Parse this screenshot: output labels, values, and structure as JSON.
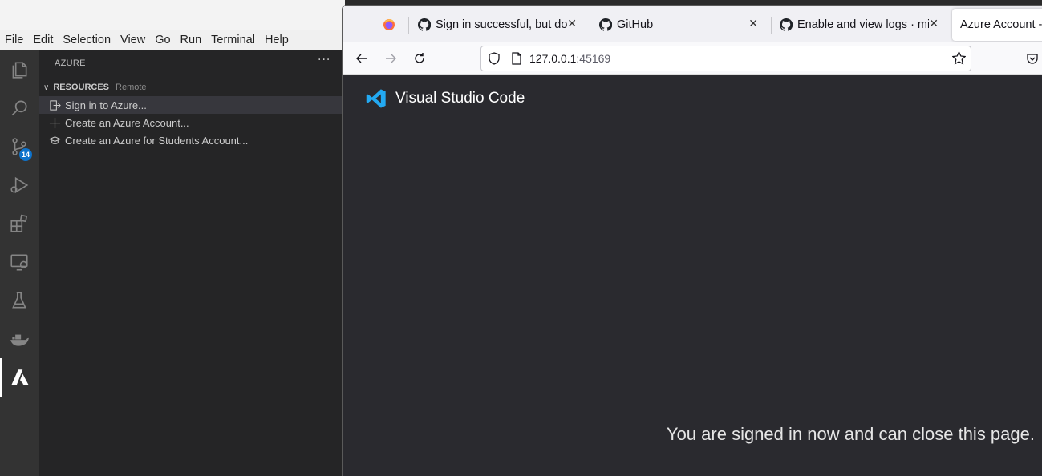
{
  "vscode": {
    "menu": [
      "File",
      "Edit",
      "Selection",
      "View",
      "Go",
      "Run",
      "Terminal",
      "Help"
    ],
    "activity_bar": {
      "source_control_badge": "14",
      "items": [
        "explorer-icon",
        "search-icon",
        "source-control-icon",
        "run-debug-icon",
        "extensions-icon",
        "remote-explorer-icon",
        "testing-icon",
        "docker-icon",
        "azure-icon"
      ]
    },
    "sidebar": {
      "title": "AZURE",
      "more_actions": "···",
      "section": {
        "label": "RESOURCES",
        "description": "Remote"
      },
      "items": [
        {
          "label": "Sign in to Azure...",
          "icon": "sign-in-icon"
        },
        {
          "label": "Create an Azure Account...",
          "icon": "plus-icon"
        },
        {
          "label": "Create an Azure for Students Account...",
          "icon": "mortarboard-icon"
        }
      ]
    }
  },
  "firefox": {
    "tabs": [
      {
        "title": "Sign in successful, but do",
        "icon": "github-icon"
      },
      {
        "title": "GitHub",
        "icon": "github-icon"
      },
      {
        "title": "Enable and view logs · mi",
        "icon": "github-icon"
      },
      {
        "title": "Azure Account -",
        "icon": "none"
      }
    ],
    "url": {
      "host": "127.0.0.1",
      "port": ":45169"
    },
    "page": {
      "brand": "Visual Studio Code",
      "message": "You are signed in now and can close this page."
    },
    "colors": {
      "vscode_blue": "#23a9f2",
      "badge": "#0e73cc"
    }
  }
}
